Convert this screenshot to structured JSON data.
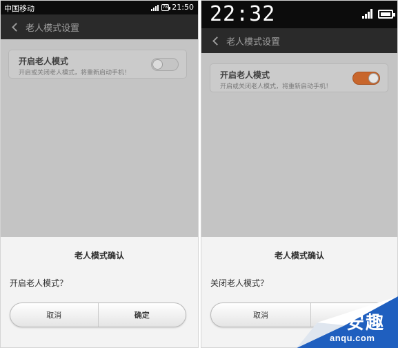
{
  "left": {
    "status": {
      "carrier": "中国移动",
      "time": "21:50",
      "battery": "78"
    },
    "action_bar": {
      "title": "老人模式设置"
    },
    "setting": {
      "title": "开启老人模式",
      "desc": "开启或关闭老人模式，将重新启动手机！",
      "toggle_state": "off"
    },
    "dialog": {
      "title": "老人模式确认",
      "message": "开启老人模式？",
      "cancel": "取消",
      "confirm": "确定"
    }
  },
  "right": {
    "status": {
      "time": "22:32"
    },
    "action_bar": {
      "title": "老人模式设置"
    },
    "setting": {
      "title": "开启老人模式",
      "desc": "开启或关闭老人模式，将重新启动手机！",
      "toggle_state": "on"
    },
    "dialog": {
      "title": "老人模式确认",
      "message": "关闭老人模式？",
      "cancel": "取消"
    }
  },
  "watermark": {
    "logo": "安趣",
    "site": "anqu.com"
  },
  "colors": {
    "accent_on": "#c8662c",
    "statusbar": "#0c0c0c",
    "actionbar": "#2a2a2a",
    "overlay": "#c4c4c4",
    "watermark_blue": "#1f5fbf"
  },
  "icons": [
    "signal-icon",
    "battery-icon",
    "back-arrow-icon"
  ]
}
